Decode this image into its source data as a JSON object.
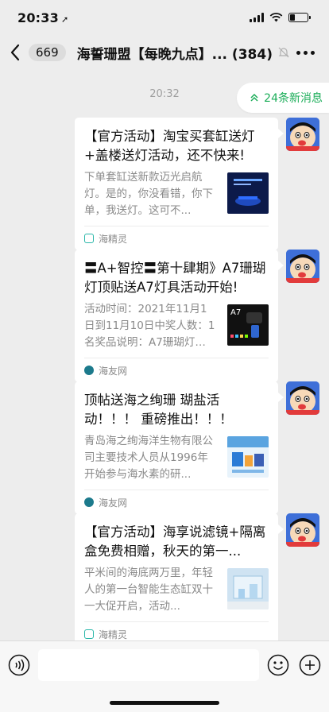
{
  "status_bar": {
    "time": "20:33",
    "battery_level": 0.3
  },
  "nav": {
    "unread_count": "669",
    "title": "海誓珊盟【每晚九点】... (384)"
  },
  "chat": {
    "timestamp": "20:32",
    "new_messages_label": "24条新消息"
  },
  "messages": [
    {
      "title": "【官方活动】淘宝买套缸送灯+盖楼送灯活动，还不快来!",
      "description": "下单套缸送新款迈光启航灯。是的，你没看错，你下单，我送灯。这可不...",
      "source": "海精灵",
      "source_icon": "sprite-app-icon",
      "thumb_color": "#0c1a4a"
    },
    {
      "title": "〓A+智控〓第十肆期》A7珊瑚灯顶贴送A7灯具活动开始!",
      "description": "活动时间：2021年11月1日到11月10日中奖人数：1名奖品说明：A7珊瑚灯一...",
      "source": "海友网",
      "source_icon": "haiyou-icon",
      "thumb_color": "#111111"
    },
    {
      "title": "顶帖送海之绚珊 瑚盐活动！！！ 重磅推出！！！",
      "description": "青岛海之绚海洋生物有限公司主要技术人员从1996年开始参与海水素的研...",
      "source": "海友网",
      "source_icon": "haiyou-icon",
      "thumb_color": "#5aa4e0"
    },
    {
      "title": "【官方活动】海享说滤镜+隔离盒免费相赠，秋天的第一...",
      "description": "平米间的海底两万里，年轻人的第一台智能生态缸双十一大促开启，活动...",
      "source": "海精灵",
      "source_icon": "sprite-app-icon",
      "thumb_color": "#cfe3f2"
    }
  ],
  "input": {
    "placeholder": ""
  },
  "colors": {
    "background": "#ededed",
    "accent_green": "#1aad58",
    "bubble": "#ffffff"
  }
}
